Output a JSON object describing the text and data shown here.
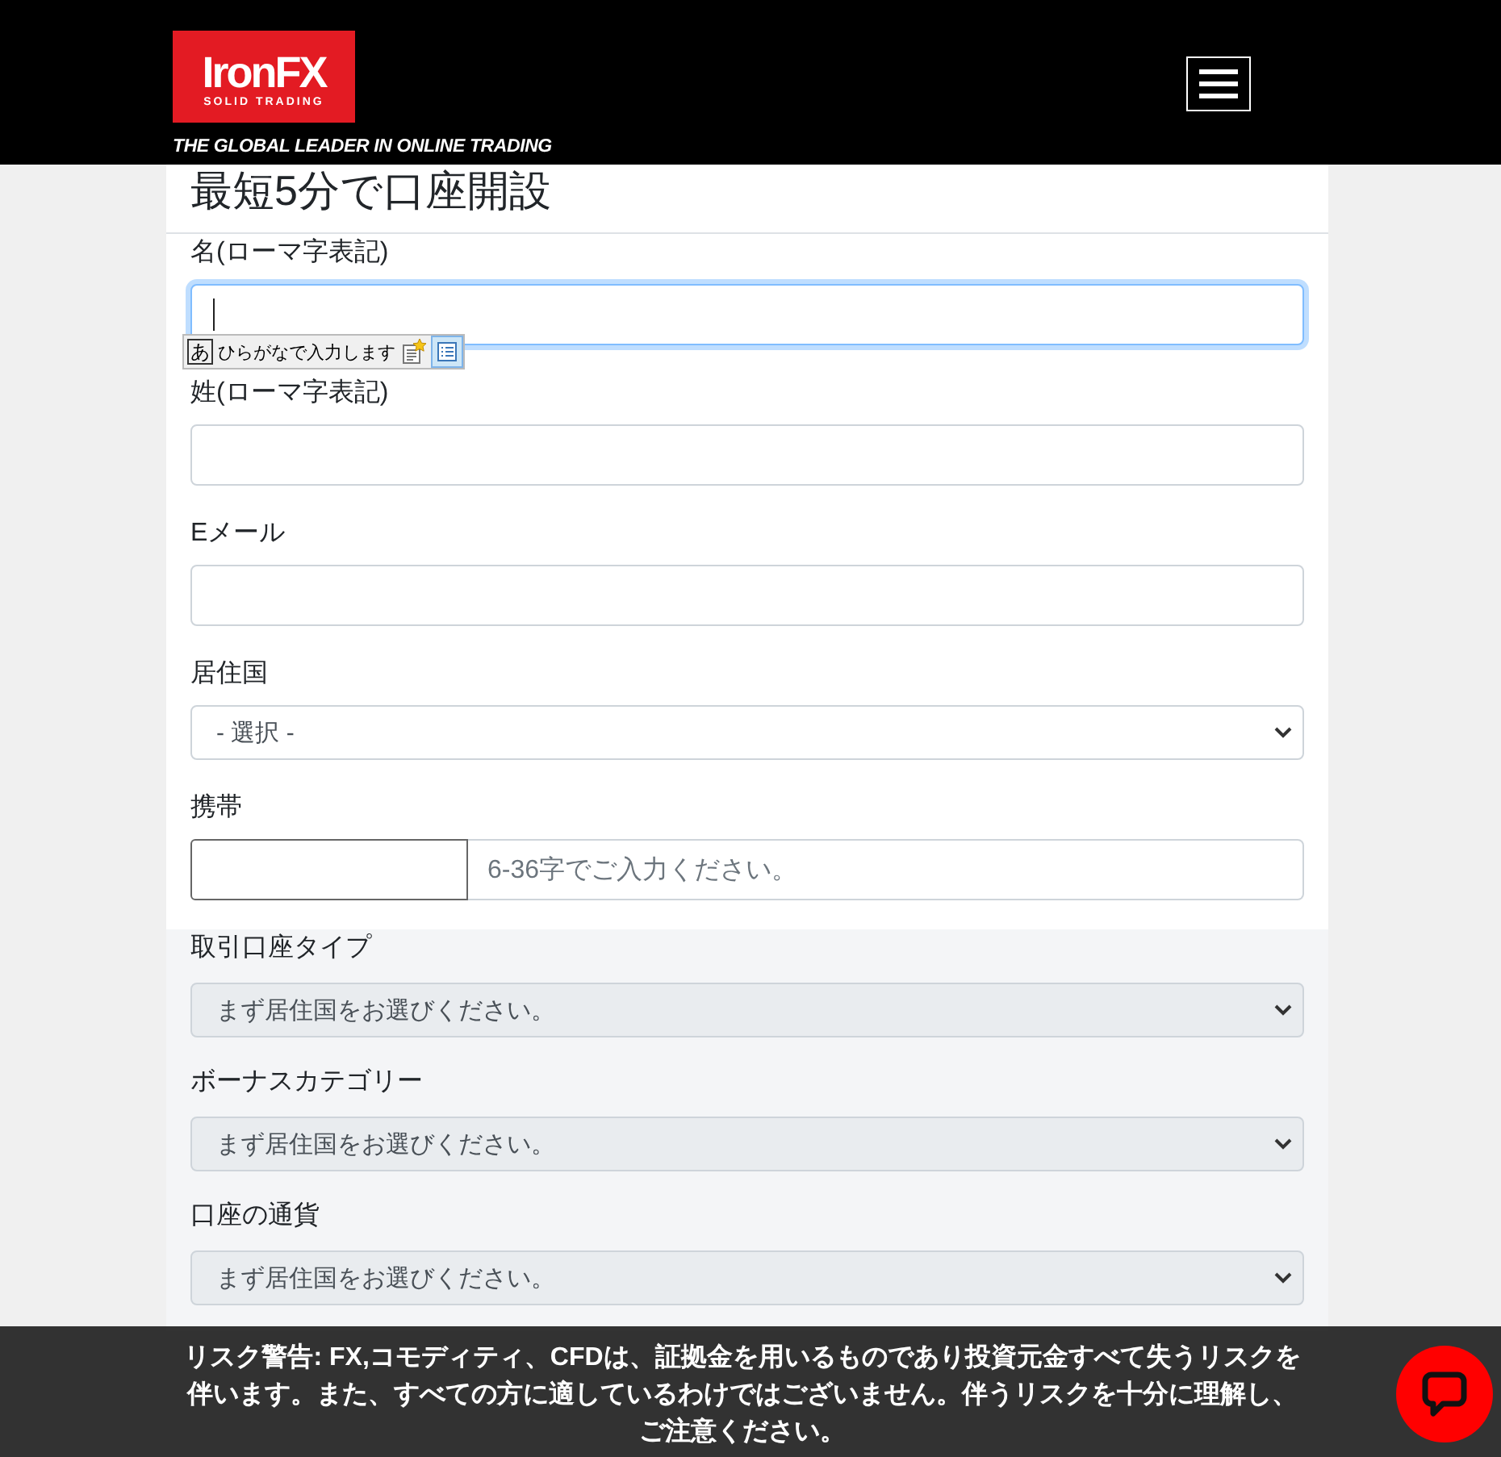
{
  "header": {
    "logo": {
      "name": "IronFX",
      "tagline": "SOLID TRADING"
    },
    "slogan": "THE GLOBAL LEADER IN ONLINE TRADING"
  },
  "form": {
    "title": "最短5分で口座開設",
    "fields": [
      {
        "kind": "text",
        "label": "名(ローマ字表記)",
        "focused": true,
        "disabled": false
      },
      {
        "kind": "text",
        "label": "姓(ローマ字表記)",
        "focused": false,
        "disabled": false
      },
      {
        "kind": "text",
        "label": "Eメール",
        "focused": false,
        "disabled": false
      },
      {
        "kind": "select",
        "label": "居住国",
        "value": "- 選択 -",
        "disabled": false
      },
      {
        "kind": "phone",
        "label": "携帯",
        "placeholder": "6-36字でご入力ください。",
        "disabled": false
      },
      {
        "kind": "select",
        "label": "取引口座タイプ",
        "value": "まず居住国をお選びください。",
        "disabled": true
      },
      {
        "kind": "select",
        "label": "ボーナスカテゴリー",
        "value": "まず居住国をお選びください。",
        "disabled": true
      },
      {
        "kind": "select",
        "label": "口座の通貨",
        "value": "まず居住国をお選びください。",
        "disabled": true
      }
    ]
  },
  "ime_bar": {
    "mode": "あ",
    "text": "ひらがなで入力します"
  },
  "risk_warning": "リスク警告: FX,コモディティ、CFDは、証拠金を用いるものであり投資元金すべて失うリスクを伴います。また、すべての方に適しているわけではございません。伴うリスクを十分に理解し、ご注意ください。"
}
